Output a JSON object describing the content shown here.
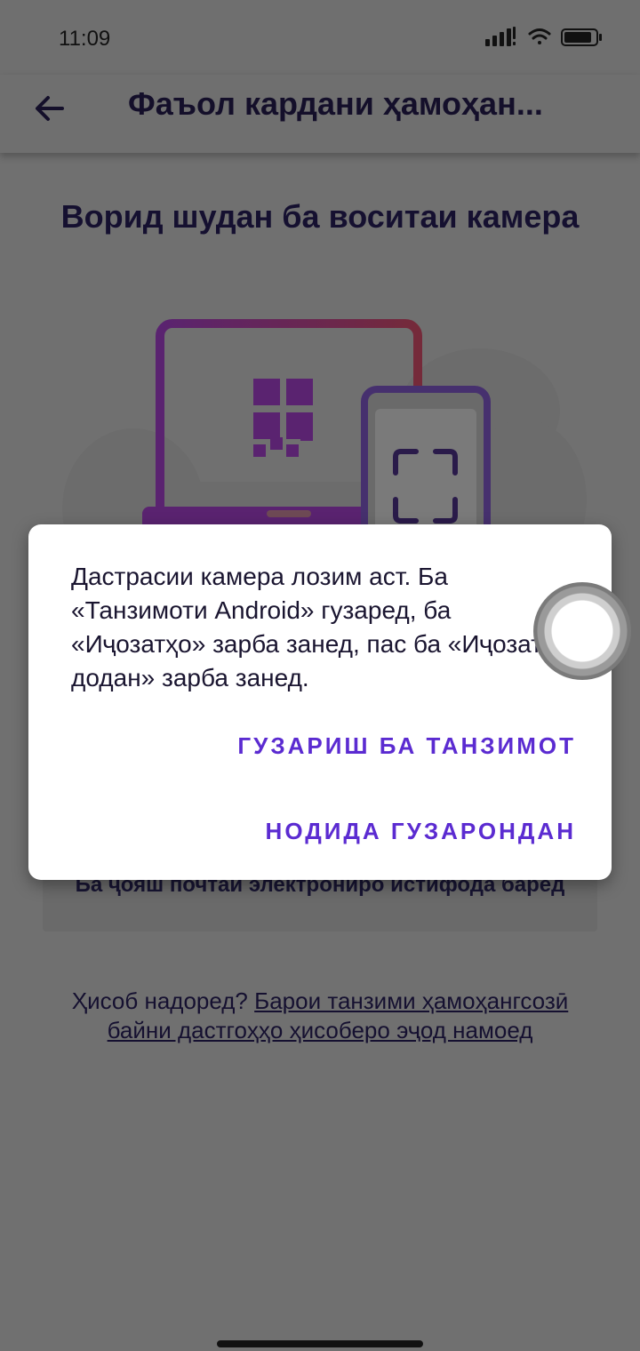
{
  "status_bar": {
    "time": "11:09"
  },
  "app_bar": {
    "title": "Фаъол кардани ҳамоҳан..."
  },
  "main": {
    "heading": "Ворид шудан ба воситаи камера",
    "email_button_label": "Ба ҷояш почтаи электрониро истифода баред",
    "signup_prefix": "Ҳисоб надоред?",
    "signup_link": "Барои танзими ҳамоҳангсозӣ байни дастгоҳҳо ҳисоберо эҷод намоед"
  },
  "dialog": {
    "message": "Дастрасии камера лозим аст. Ба «Танзимоти Android» гузаред, ба «Иҷозатҳо» зарба занед, пас ба «Иҷозат додан» зарба занед.",
    "primary_button": "ГУЗАРИШ БА ТАНЗИМОТ",
    "secondary_button": "НОДИДА ГУЗАРОНДАН"
  },
  "colors": {
    "accent": "#5b2bd1",
    "dialog_bg": "#ffffff",
    "scrim": "#707070"
  },
  "icons": [
    "back-arrow-icon",
    "signal-icon",
    "wifi-icon",
    "battery-icon",
    "qr-code-icon",
    "scan-frame-icon"
  ]
}
